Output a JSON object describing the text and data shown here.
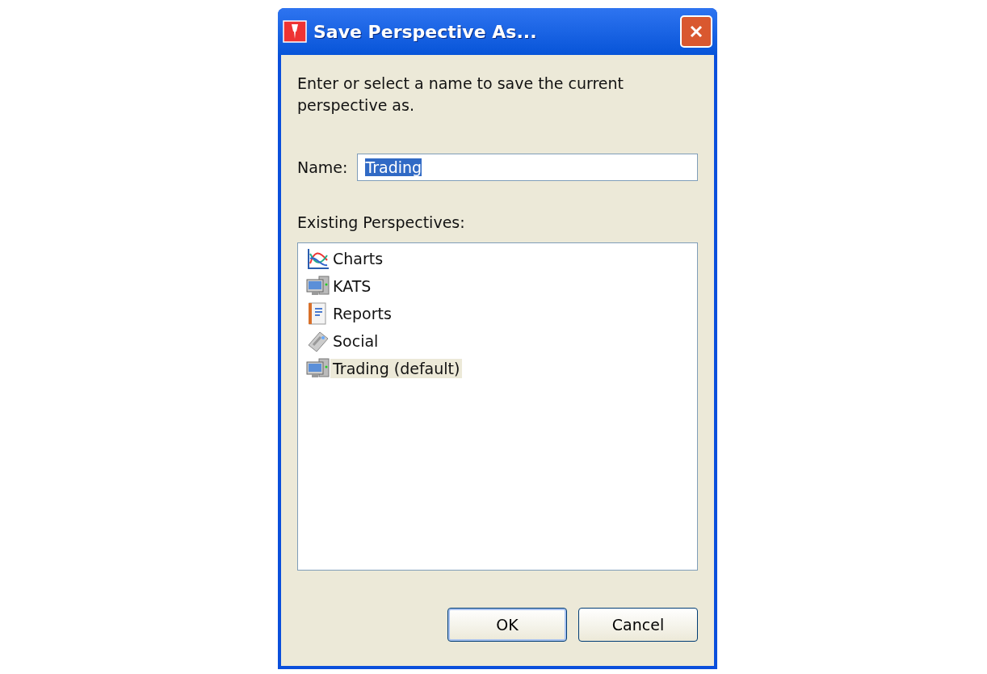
{
  "window": {
    "title": "Save Perspective As..."
  },
  "instructions": "Enter or select a name to save the current perspective as.",
  "name_field": {
    "label": "Name:",
    "value": "Trading"
  },
  "perspectives": {
    "label": "Existing Perspectives:",
    "items": [
      {
        "label": "Charts",
        "kind": "chart",
        "selected": false
      },
      {
        "label": "KATS",
        "kind": "computer",
        "selected": false
      },
      {
        "label": "Reports",
        "kind": "notebook",
        "selected": false
      },
      {
        "label": "Social",
        "kind": "tag",
        "selected": false
      },
      {
        "label": "Trading (default)",
        "kind": "computer",
        "selected": true
      }
    ]
  },
  "buttons": [
    {
      "label": "OK",
      "default": true
    },
    {
      "label": "Cancel",
      "default": false
    }
  ]
}
